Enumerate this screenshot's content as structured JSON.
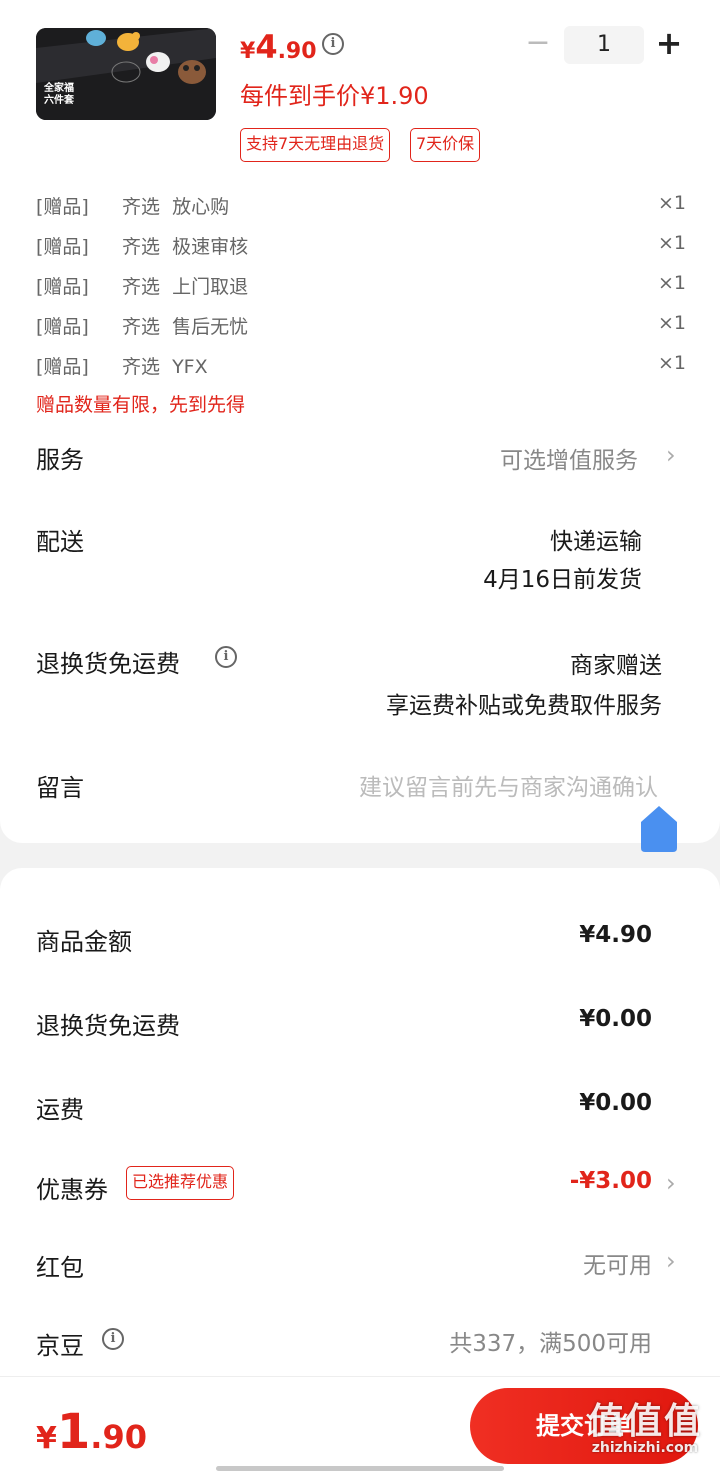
{
  "product": {
    "image_text": [
      "全家福",
      "六件套"
    ],
    "price": {
      "currency": "¥",
      "integer": "4",
      "decimal": ".90"
    },
    "after_price_label": "每件到手价¥1.90",
    "tags": [
      "支持7天无理由退货",
      "7天价保"
    ],
    "quantity": {
      "minus": "−",
      "value": "1",
      "plus": "+"
    }
  },
  "gifts": [
    {
      "tag": "[赠品]",
      "name": "齐选  放心购",
      "qty": "×1"
    },
    {
      "tag": "[赠品]",
      "name": "齐选  极速审核",
      "qty": "×1"
    },
    {
      "tag": "[赠品]",
      "name": "齐选  上门取退",
      "qty": "×1"
    },
    {
      "tag": "[赠品]",
      "name": "齐选  售后无忧",
      "qty": "×1"
    },
    {
      "tag": "[赠品]",
      "name": "齐选  YFX",
      "qty": "×1"
    }
  ],
  "gift_note": "赠品数量有限，先到先得",
  "service": {
    "label": "服务",
    "value": "可选增值服务"
  },
  "delivery": {
    "label": "配送",
    "method": "快递运输",
    "date": "4月16日前发货"
  },
  "return_shipping": {
    "label": "退换货免运费",
    "line1": "商家赠送",
    "line2": "享运费补贴或免费取件服务"
  },
  "message": {
    "label": "留言",
    "placeholder": "建议留言前先与商家沟通确认"
  },
  "summary": {
    "goods_amount": {
      "label": "商品金额",
      "value": "¥4.90"
    },
    "return_fee": {
      "label": "退换货免运费",
      "value": "¥0.00"
    },
    "shipping": {
      "label": "运费",
      "value": "¥0.00"
    },
    "coupon": {
      "label": "优惠券",
      "tag": "已选推荐优惠",
      "value": "-¥3.00"
    },
    "red_packet": {
      "label": "红包",
      "value": "无可用"
    },
    "jingdou": {
      "label": "京豆",
      "value": "共337，满500可用"
    }
  },
  "footer": {
    "total": {
      "currency": "¥",
      "integer": "1",
      "decimal": ".90"
    },
    "submit_label": "提交订单",
    "watermark": "值值值",
    "watermark_url": "zhizhizhi.com"
  },
  "colors": {
    "accent": "#e1251b",
    "blue_button": "#4a90f0"
  }
}
